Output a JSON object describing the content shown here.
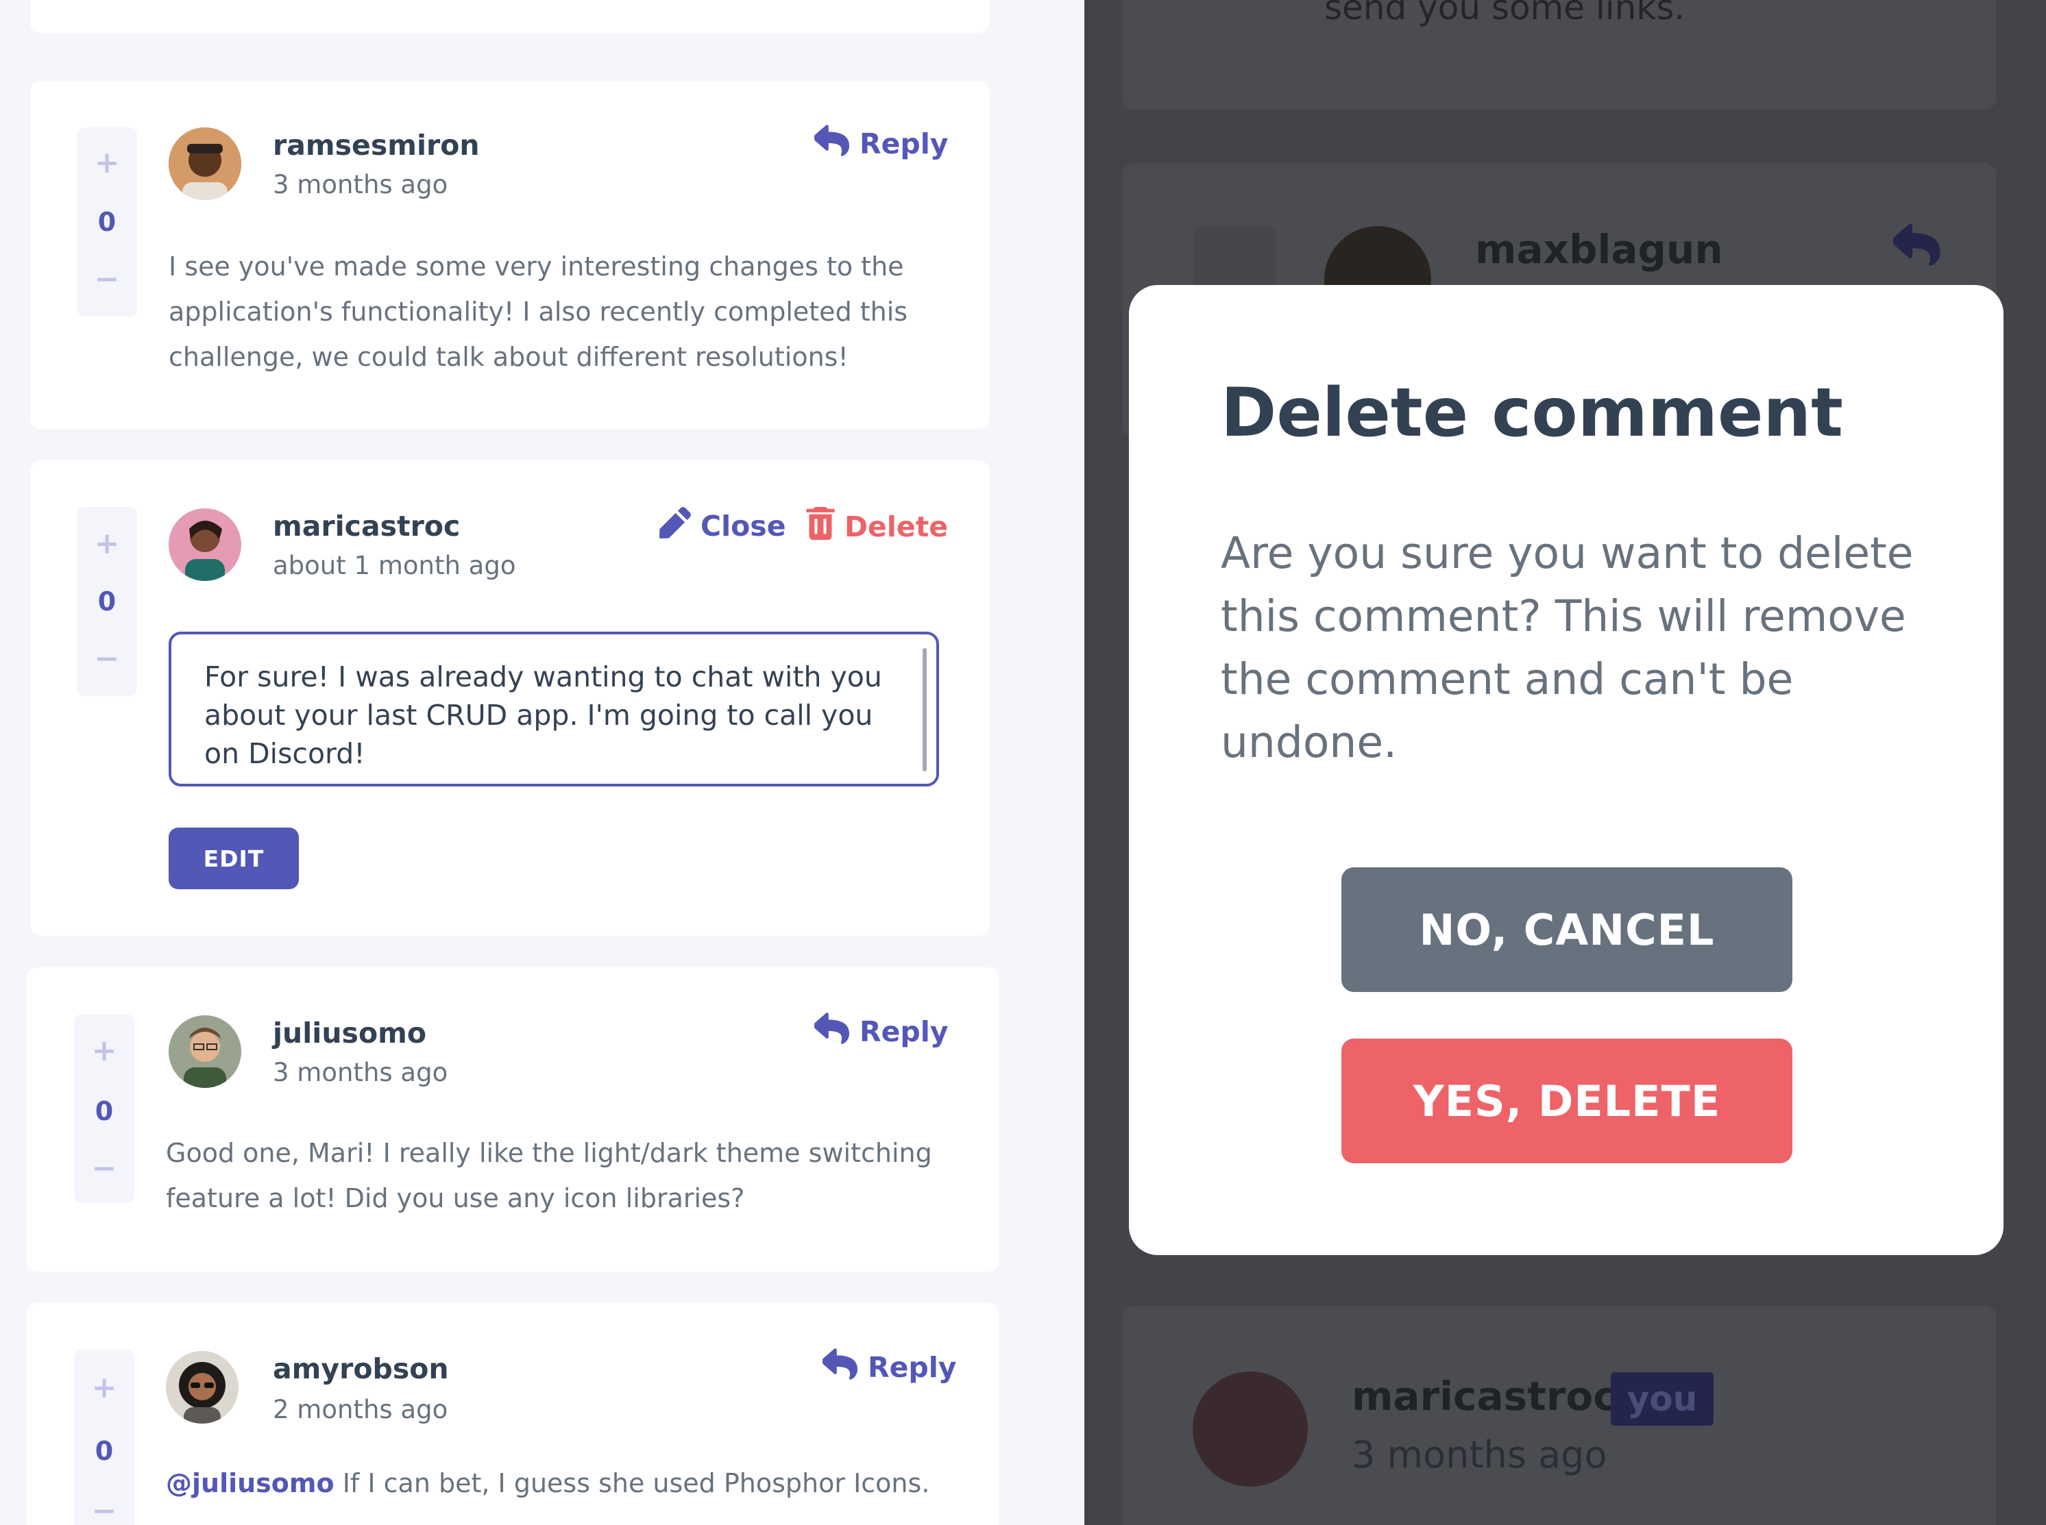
{
  "colors": {
    "accent": "#5357b6",
    "danger": "#ed6368",
    "cancel": "#67727e",
    "page_bg": "#f5f6fa",
    "overlay_bg": "#434448"
  },
  "comments": [
    {
      "username": "ramsesmiron",
      "time": "3 months ago",
      "score": "0",
      "body": "I see you've made some very interesting changes to the application's functionality! I also recently completed this challenge, we could talk about different resolutions!",
      "reply_label": "Reply"
    },
    {
      "username": "maricastroc",
      "time": "about 1 month ago",
      "score": "0",
      "close_label": "Close",
      "delete_label": "Delete",
      "edit_text": "For sure! I was already wanting to chat with you about your last CRUD app. I'm going to call you on Discord!",
      "edit_button": "EDIT"
    },
    {
      "username": "juliusomo",
      "time": "3 months ago",
      "score": "0",
      "body": "Good one, Mari! I really like the light/dark theme switching feature a lot! Did you use any icon libraries?",
      "reply_label": "Reply"
    },
    {
      "username": "amyrobson",
      "time": "2 months ago",
      "score": "0",
      "mention": "@juliusomo",
      "body": " If I can bet, I guess she used Phosphor Icons.",
      "reply_label": "Reply"
    }
  ],
  "vote": {
    "plus": "+",
    "minus": "−"
  },
  "background": {
    "top_text": "send you some links.",
    "card_user": "maxblagun",
    "bottom_user": "maricastroc",
    "bottom_badge": "you",
    "bottom_time": "3 months ago"
  },
  "modal": {
    "title": "Delete comment",
    "text": "Are you sure you want to delete this comment? This will remove the comment and can't be undone.",
    "cancel_label": "NO, CANCEL",
    "delete_label": "YES, DELETE"
  },
  "icons": {
    "reply": "reply-arrow-icon",
    "edit": "pencil-icon",
    "delete": "trash-icon"
  }
}
